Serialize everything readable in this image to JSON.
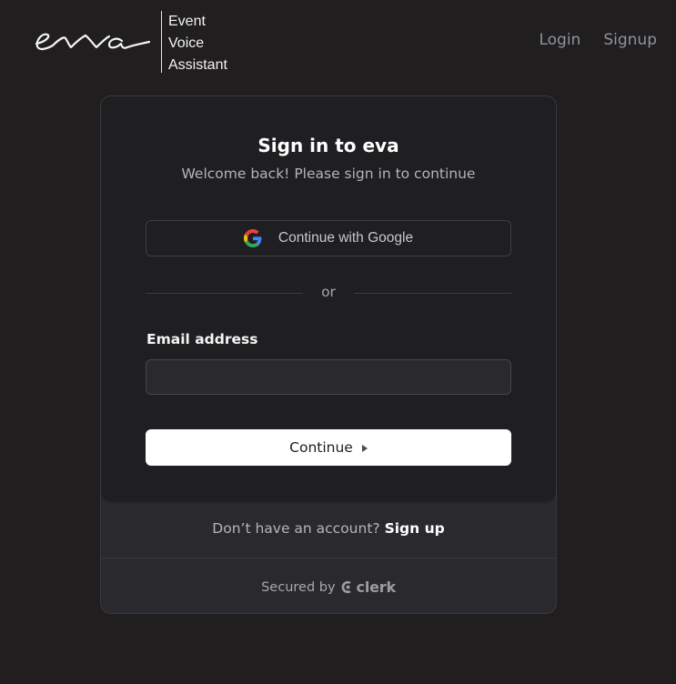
{
  "header": {
    "logo_script": "eva",
    "logo_words": [
      "Event",
      "Voice",
      "Assistant"
    ],
    "nav": {
      "login": "Login",
      "signup": "Signup"
    }
  },
  "card": {
    "title": "Sign in to eva",
    "subtitle": "Welcome back! Please sign in to continue",
    "google_button": "Continue with Google",
    "divider_text": "or",
    "email_label": "Email address",
    "email_value": "",
    "email_placeholder": "",
    "continue_button": "Continue",
    "footer_prompt": "Don’t have an account?",
    "footer_link": "Sign up",
    "secured_by": "Secured by",
    "secured_brand": "clerk"
  },
  "colors": {
    "background": "#201e1e",
    "card": "#1f1f22",
    "card_footer": "#2a2a2e",
    "nav_link": "#8f949d",
    "primary_button": "#ffffff"
  },
  "icons": {
    "google": "google-g-icon",
    "caret": "caret-right-icon",
    "clerk": "clerk-logo-icon"
  }
}
